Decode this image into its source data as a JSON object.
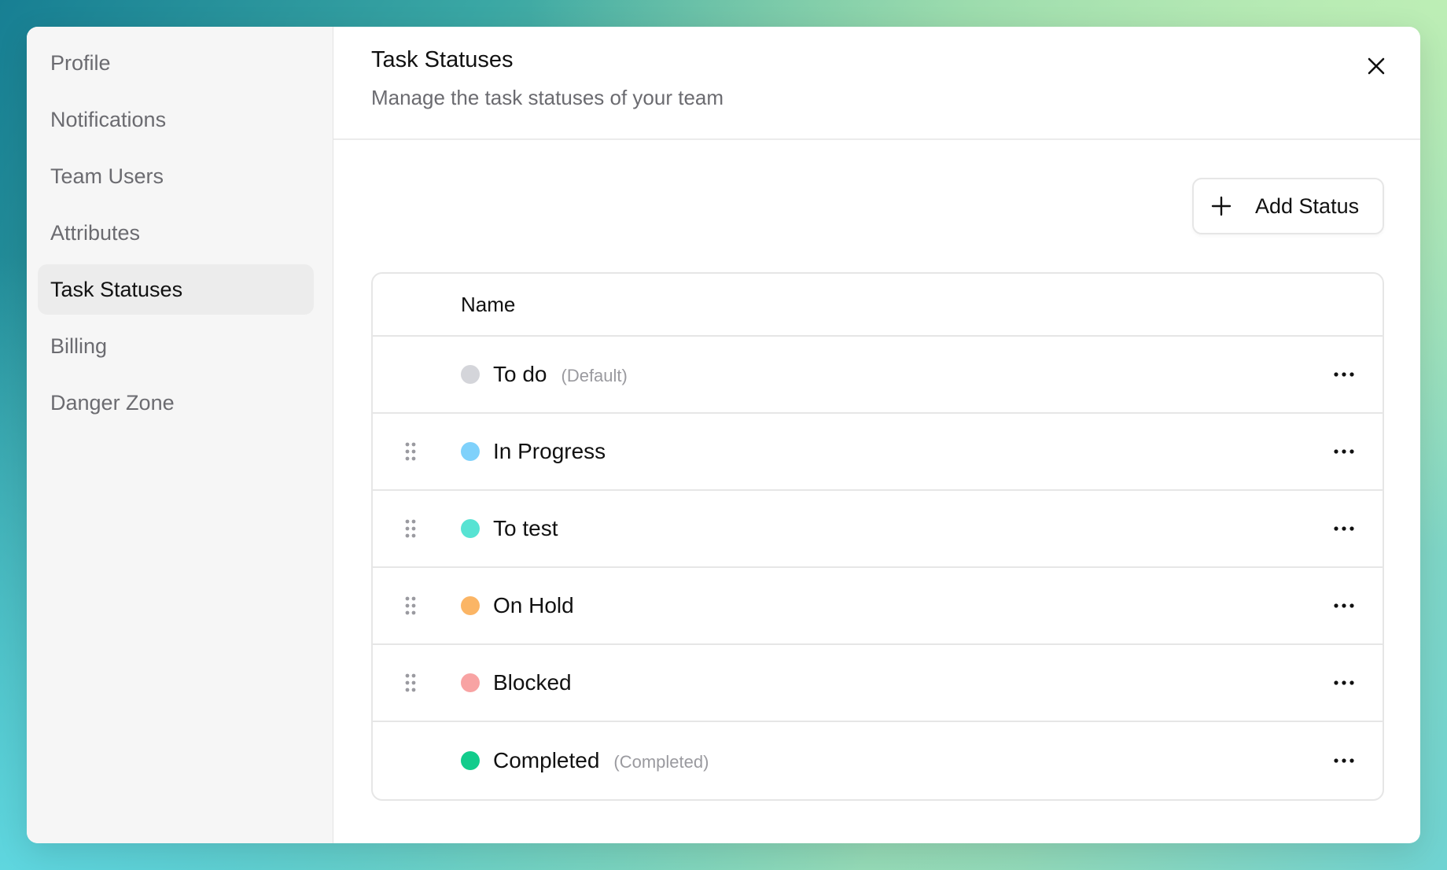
{
  "sidebar": {
    "items": [
      {
        "label": "Profile"
      },
      {
        "label": "Notifications"
      },
      {
        "label": "Team Users"
      },
      {
        "label": "Attributes"
      },
      {
        "label": "Task Statuses",
        "active": true
      },
      {
        "label": "Billing"
      },
      {
        "label": "Danger Zone"
      }
    ]
  },
  "header": {
    "title": "Task Statuses",
    "subtitle": "Manage the task statuses of your team"
  },
  "toolbar": {
    "add_label": "Add Status"
  },
  "table": {
    "column_name": "Name",
    "rows": [
      {
        "name": "To do",
        "tag": "(Default)",
        "color": "#d4d5da",
        "draggable": false
      },
      {
        "name": "In Progress",
        "tag": "",
        "color": "#7fd1fb",
        "draggable": true
      },
      {
        "name": "To test",
        "tag": "",
        "color": "#57e3d3",
        "draggable": true
      },
      {
        "name": "On Hold",
        "tag": "",
        "color": "#fbb565",
        "draggable": true
      },
      {
        "name": "Blocked",
        "tag": "",
        "color": "#f8a3a3",
        "draggable": true
      },
      {
        "name": "Completed",
        "tag": "(Completed)",
        "color": "#12cc8c",
        "draggable": false
      }
    ]
  },
  "icons": {
    "close": "close-icon",
    "add": "plus-icon",
    "drag": "drag-handle-icon",
    "more": "more-horizontal-icon"
  }
}
